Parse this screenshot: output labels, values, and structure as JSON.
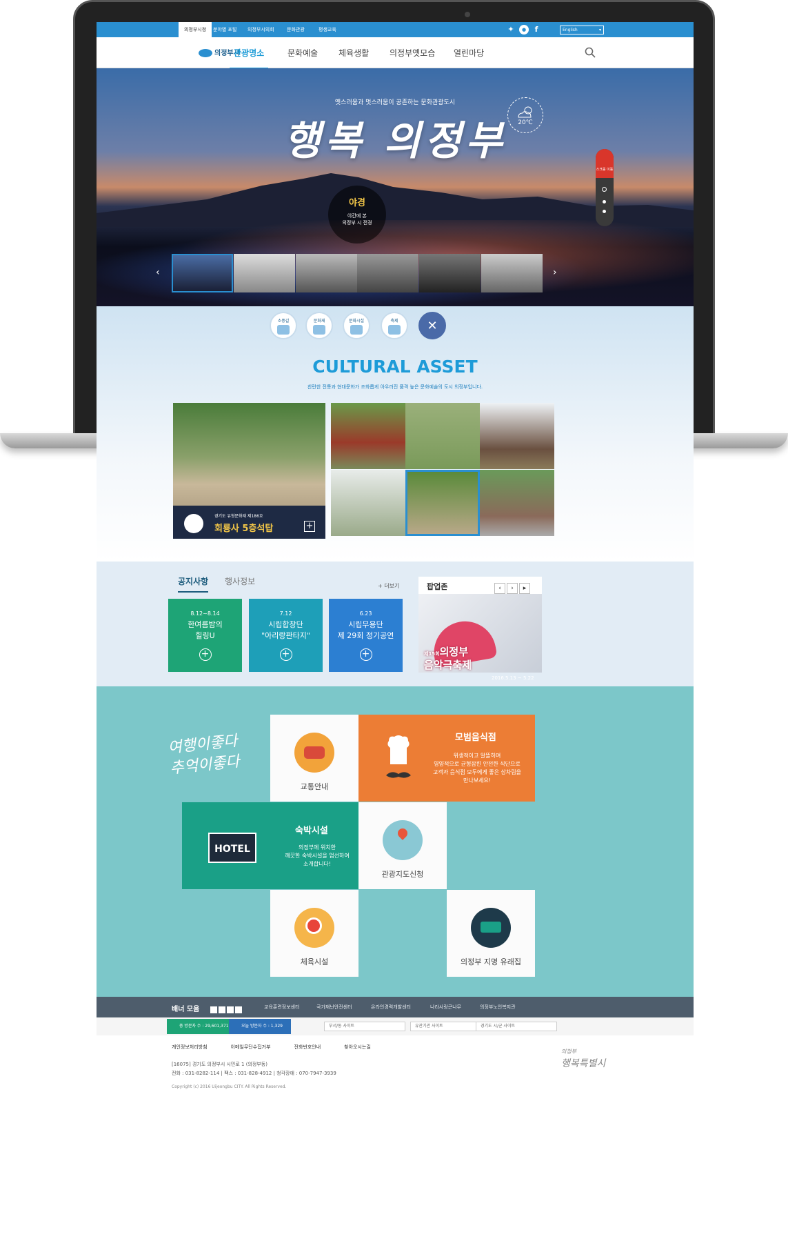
{
  "top_tabs": [
    "의정부시청",
    "분야별 포털",
    "의정부시의회",
    "문화관광",
    "평생교육"
  ],
  "language": "English",
  "logo": "의정부시",
  "menu": [
    "관광명소",
    "문화예술",
    "체육생활",
    "의정부옛모습",
    "열린마당"
  ],
  "hero": {
    "subtitle": "옛스러움과 멋스러움이 공존하는 문화관광도시",
    "title": "행복 의정부",
    "temperature": "20℃",
    "badge_title": "야경",
    "badge_desc_1": "야간에 본",
    "badge_desc_2": "의정부 시 전경",
    "scroll_label": "스크롤 이동"
  },
  "categories": [
    "소풍길",
    "문화재",
    "문화시설",
    "축제"
  ],
  "cultural": {
    "title": "CULTURAL ASSET",
    "desc": "찬란한 전통과 현대문화가 조화롭게 아우러진 품격 높은 문화예술의 도시 의정부입니다.",
    "feature_sub": "경기도 유형문화재 제186호",
    "feature_name": "회룡사 5층석탑"
  },
  "notice": {
    "tab_1": "공지사항",
    "tab_2": "행사정보",
    "more": "+ 더보기",
    "cards": [
      {
        "date": "8.12~8.14",
        "title_1": "한여름밤의",
        "title_2": "힐링U",
        "color": "#1ea476"
      },
      {
        "date": "7.12",
        "title_1": "시립합창단",
        "title_2": "\"아리랑판타지\"",
        "color": "#1e9fb8"
      },
      {
        "date": "6.23",
        "title_1": "시립무용단",
        "title_2": "제 29회 정기공연",
        "color": "#2c7fd2"
      }
    ],
    "popup_title": "팝업존",
    "popup_fest_no": "제15회",
    "popup_fest_1": "의정부",
    "popup_fest_2": "음악극축제",
    "popup_date": "2016.5.13 ~ 5.22"
  },
  "tour": {
    "script_1": "여행이좋다",
    "script_2": "추억이좋다",
    "traffic": "교통안내",
    "restaurant_title": "모범음식점",
    "restaurant_desc_1": "위생적이고 알뜰하며",
    "restaurant_desc_2": "영양적으로 균형잡힌 안전한 식단으로",
    "restaurant_desc_3": "고객과 음식점 모두에게 좋은 상차림을",
    "restaurant_desc_4": "만나보세요!",
    "lodging_title": "숙박시설",
    "lodging_desc_1": "의정부에 위치한",
    "lodging_desc_2": "깨끗한 숙박시설을 엄선하여",
    "lodging_desc_3": "소개합니다!",
    "hotel": "HOTEL",
    "map": "관광지도신청",
    "sports": "체육시설",
    "placename": "의정부 지명 유래집"
  },
  "footer": {
    "banner": "배너 모음",
    "links": [
      "교육훈련정보센터",
      "국가재난안전센터",
      "온라인경력개발센터",
      "나라사랑큰나무",
      "의정부노인복지관"
    ],
    "total_visitors": "총 방문자 수 : 29,601,371",
    "today_visitors": "오늘 방문자 수 : 1,329",
    "selects": [
      "부서/동 사이트",
      "유관기관 사이트",
      "경기도 시/군 사이트"
    ],
    "bottom_links": [
      "개인정보처리방침",
      "이메일무단수집거부",
      "전화번호안내",
      "찾아오시는길"
    ],
    "address": "[16075] 경기도 의정부시 시민로 1 (의정부동)",
    "contact": "전화 : 031-8282-114  |  팩스 : 031-828-4912  |  청각장애 : 070-7947-3939",
    "copyright": "Copyright (c) 2016 Uijeongbu CITY. All Rights Reserved.",
    "logo_small": "의정부",
    "logo_big": "행복특별시"
  }
}
